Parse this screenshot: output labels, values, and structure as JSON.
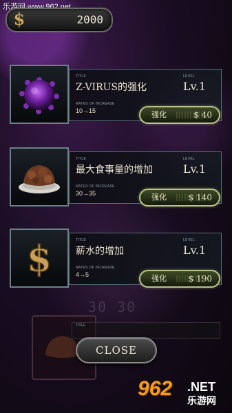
{
  "watermark_top": "乐游网 www.962.net",
  "money": {
    "icon": "dollar-icon",
    "value": "2000"
  },
  "labels": {
    "title_caption": "TITLE",
    "level_caption": "LEVEL",
    "rates_caption": "RATES OF INCREASE",
    "upgrade": "强化"
  },
  "upgrades": [
    {
      "icon": "virus-icon",
      "title": "Z-VIRUS的强化",
      "level": "Lv.1",
      "rates": "10→15",
      "price": "$ 40"
    },
    {
      "icon": "meat-icon",
      "title": "最大食事量的增加",
      "level": "Lv.1",
      "rates": "30→35",
      "price": "$ 140"
    },
    {
      "icon": "dollar-sign-icon",
      "title": "薪水的增加",
      "level": "Lv.1",
      "rates": "4→5",
      "price": "$ 190"
    }
  ],
  "background_number": "30 30",
  "close_label": "CLOSE",
  "watermark_logo": {
    "num": "962",
    "net": ".NET",
    "cn": "乐游网"
  },
  "colors": {
    "accent": "#b9c38a",
    "frame": "#5b6e78",
    "text": "#efe6cf"
  }
}
